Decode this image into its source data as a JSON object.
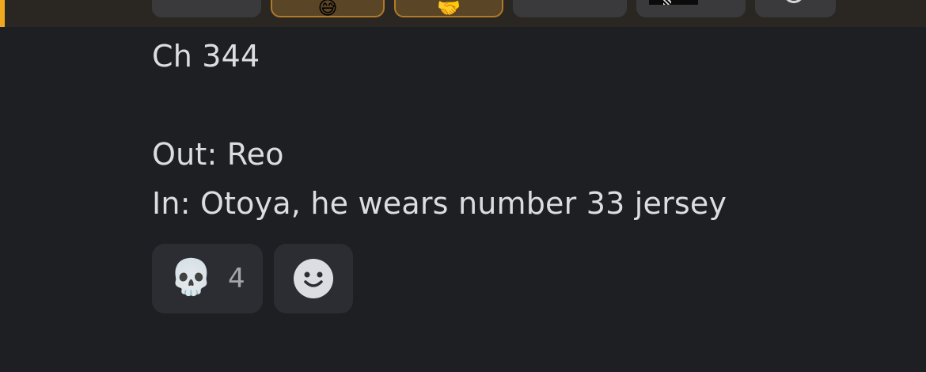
{
  "top_reactions": [
    {
      "icon": "emoji-reaction-icon",
      "active": false
    },
    {
      "icon": "emoji-reaction-icon",
      "active": true
    },
    {
      "icon": "emoji-reaction-icon",
      "active": true
    },
    {
      "icon": "sticker-reaction-icon",
      "active": false
    },
    {
      "icon": "image-reaction-icon",
      "active": false
    },
    {
      "icon": "emoji-reaction-icon",
      "active": false
    }
  ],
  "message": {
    "line1": "Ch 344",
    "line2": "",
    "line3": "Out: Reo",
    "line4": "In: Otoya, he wears number 33 jersey"
  },
  "reactions": [
    {
      "emoji": "💀",
      "icon": "skull-icon",
      "count": "4"
    },
    {
      "icon": "add-reaction-icon"
    }
  ],
  "colors": {
    "background": "#1e1f23",
    "text": "#dbdee1",
    "reaction_bg": "#2c2d33",
    "highlight": "#f0a91e"
  }
}
